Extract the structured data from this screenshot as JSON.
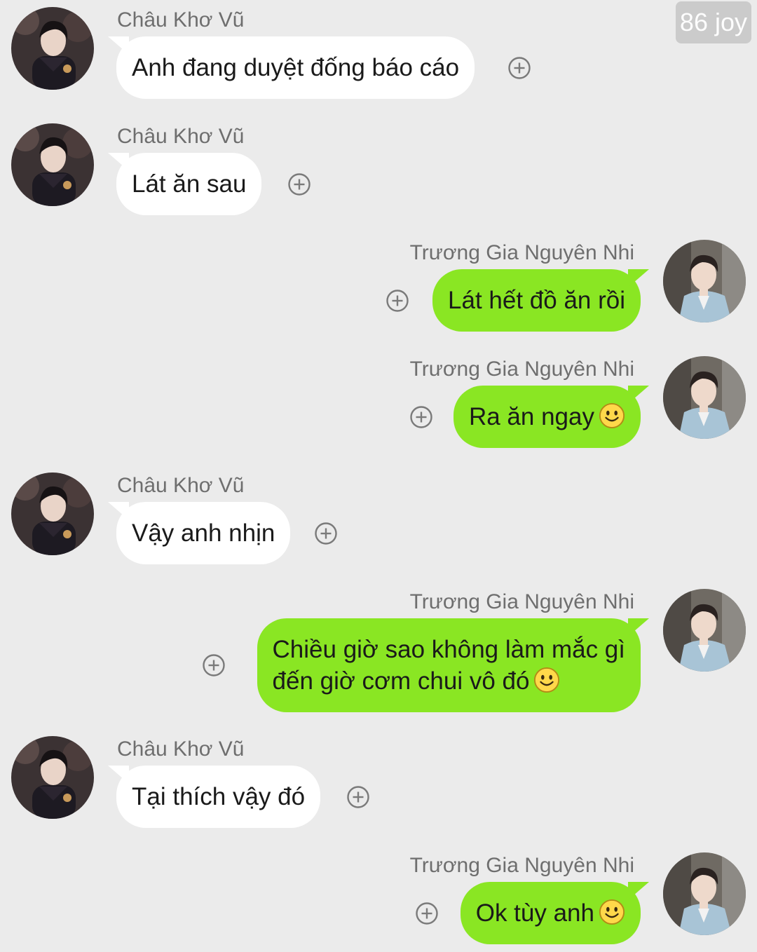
{
  "watermark": "86 joy",
  "colors": {
    "background": "#ebebeb",
    "incoming_bubble": "#ffffff",
    "outgoing_bubble": "#8ae623",
    "name_text": "#6e6e6e"
  },
  "messages": [
    {
      "sender": "Châu Khơ Vũ",
      "text": "Anh đang duyệt đống báo cáo"
    },
    {
      "sender": "Châu Khơ Vũ",
      "text": "Lát ăn sau"
    },
    {
      "sender": "Trương Gia Nguyên Nhi",
      "text": "Lát hết đồ ăn rồi"
    },
    {
      "sender": "Trương Gia Nguyên Nhi",
      "text": "Ra ăn ngay",
      "emoji": "smiley-emoji"
    },
    {
      "sender": "Châu Khơ Vũ",
      "text": "Vậy anh nhịn"
    },
    {
      "sender": "Trương Gia Nguyên Nhi",
      "line1": "Chiều giờ sao không làm mắc gì",
      "line2": "đến giờ cơm chui vô đó",
      "emoji": "smiley-emoji"
    },
    {
      "sender": "Châu Khơ Vũ",
      "text": "Tại thích vậy đó"
    },
    {
      "sender": "Trương Gia Nguyên Nhi",
      "text": "Ok tùy anh",
      "emoji": "smiley-emoji"
    }
  ],
  "icons": {
    "add_reaction": "plus-circle-icon",
    "avatar_left": "avatar-chau-kho-vu",
    "avatar_right": "avatar-truong-gia-nguyen-nhi"
  }
}
